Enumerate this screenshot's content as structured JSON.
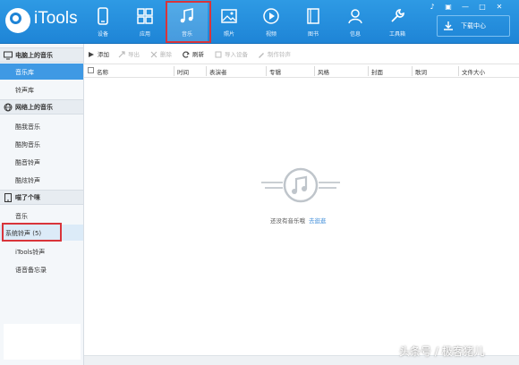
{
  "app": {
    "title": "iTools"
  },
  "window_controls": [
    "♪",
    "▣",
    "—",
    "□",
    "✕"
  ],
  "nav": [
    {
      "label": "设备",
      "icon": "phone-icon"
    },
    {
      "label": "应用",
      "icon": "apps-grid-icon"
    },
    {
      "label": "音乐",
      "icon": "music-note-icon",
      "active": true
    },
    {
      "label": "照片",
      "icon": "photo-icon"
    },
    {
      "label": "视频",
      "icon": "video-play-icon"
    },
    {
      "label": "图书",
      "icon": "book-icon"
    },
    {
      "label": "信息",
      "icon": "person-icon"
    },
    {
      "label": "工具箱",
      "icon": "wrench-icon"
    }
  ],
  "download_center": {
    "label": "下载中心",
    "icon": "download-icon"
  },
  "sidebar": {
    "sections": [
      {
        "title": "电脑上的音乐",
        "icon": "monitor-icon",
        "items": [
          {
            "label": "音乐库",
            "selected": true
          },
          {
            "label": "铃声库"
          }
        ]
      },
      {
        "title": "网络上的音乐",
        "icon": "globe-icon",
        "items": [
          {
            "label": "酷我音乐"
          },
          {
            "label": "酷狗音乐"
          },
          {
            "label": "酷音铃声"
          },
          {
            "label": "酷炫铃声"
          }
        ]
      },
      {
        "title": "喵了个咪",
        "icon": "tablet-icon",
        "items": [
          {
            "label": "音乐"
          },
          {
            "label": "系统铃声 (5)",
            "highlighted": true
          },
          {
            "label": "iTools铃声"
          },
          {
            "label": "语音备忘录"
          }
        ]
      }
    ]
  },
  "toolbar": {
    "add": "添加",
    "import": "导出",
    "delete": "删除",
    "refresh": "刷新",
    "import_device": "导入设备",
    "make_ringtone": "制作铃声"
  },
  "columns": [
    "名称",
    "时间",
    "表演者",
    "专辑",
    "风格",
    "封面",
    "歌词",
    "文件大小"
  ],
  "empty_state": {
    "message": "还没有音乐哦",
    "link": "去逛逛"
  },
  "watermark": "头条号 / 极客猪儿",
  "colors": {
    "topbar": "#1e84d6",
    "selected": "#3f99e4",
    "highlight_border": "#d9343a",
    "link": "#3a8ad8"
  }
}
